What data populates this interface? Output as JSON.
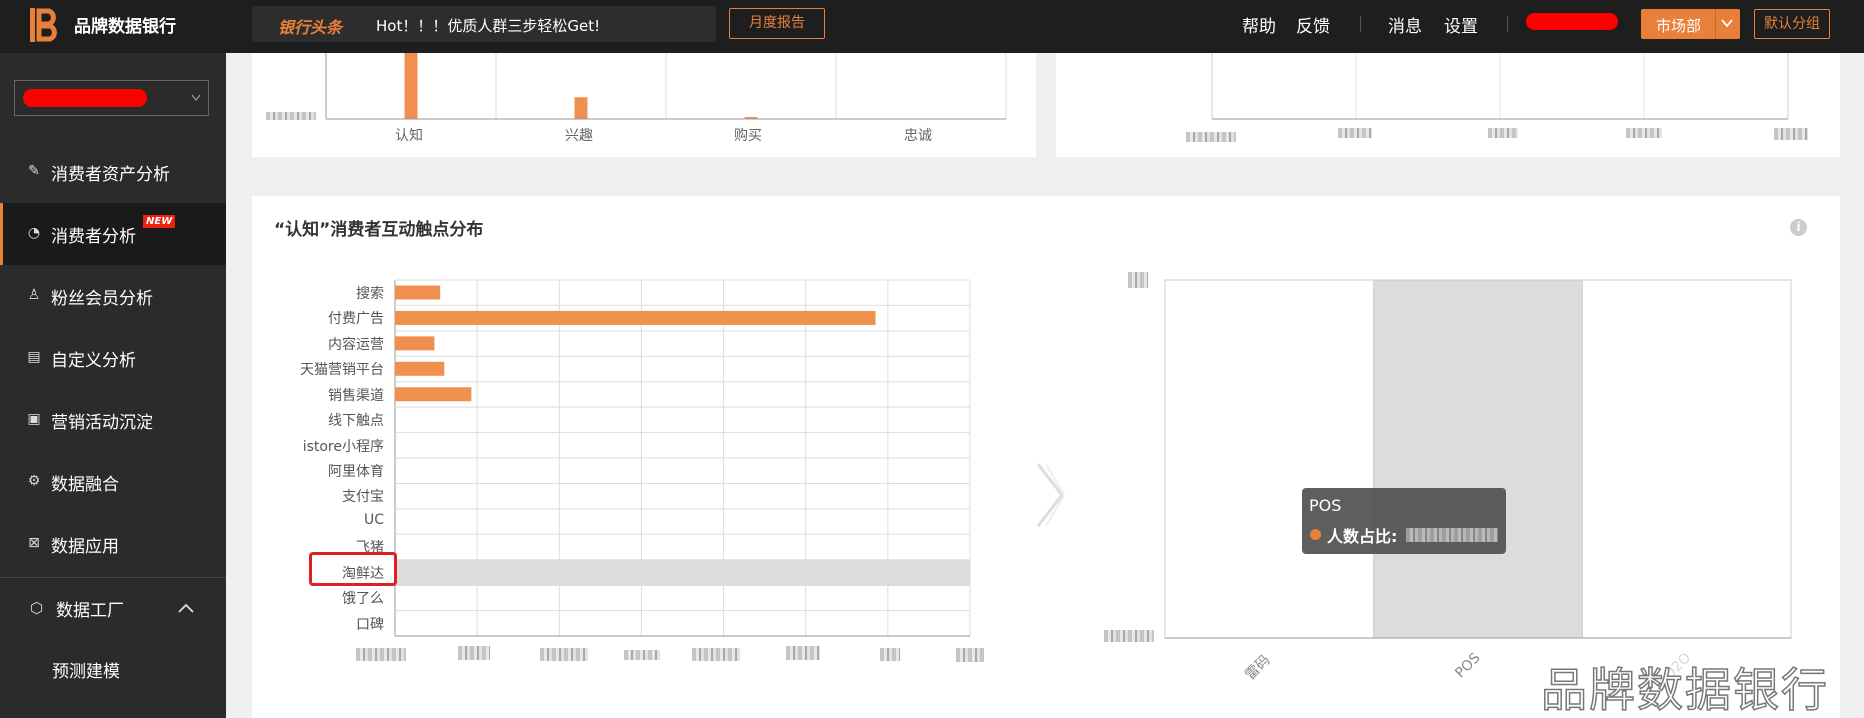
{
  "topbar": {
    "logo_text": "品牌数据银行",
    "news_tag": "银行头条",
    "news_text": "Hot！！！优质人群三步轻松Get!",
    "monthly_report": "月度报告",
    "nav": [
      "帮助",
      "反馈",
      "消息",
      "设置"
    ],
    "department": "市场部",
    "default_group": "默认分组"
  },
  "sidebar": {
    "items": [
      {
        "label": "消费者资产分析",
        "icon": "edit-icon"
      },
      {
        "label": "消费者分析",
        "icon": "gauge-icon",
        "badge": "NEW"
      },
      {
        "label": "粉丝会员分析",
        "icon": "users-icon"
      },
      {
        "label": "自定义分析",
        "icon": "custom-icon"
      },
      {
        "label": "营销活动沉淀",
        "icon": "campaign-icon"
      },
      {
        "label": "数据融合",
        "icon": "merge-icon"
      },
      {
        "label": "数据应用",
        "icon": "app-icon"
      }
    ],
    "factory": {
      "label": "数据工厂",
      "icon": "cube-icon"
    },
    "factory_sub": [
      "预测建模"
    ]
  },
  "top_left_chart": {
    "categories": [
      "认知",
      "兴趣",
      "购买",
      "忠诚"
    ]
  },
  "main_card": {
    "title": "“认知”消费者互动触点分布"
  },
  "chart_data": [
    {
      "type": "bar",
      "orientation": "horizontal",
      "categories": [
        "搜索",
        "付费广告",
        "内容运营",
        "天猫营销平台",
        "销售渠道",
        "线下触点",
        "istore小程序",
        "阿里体育",
        "支付宝",
        "UC",
        "飞猪",
        "淘鲜达",
        "饿了么",
        "口碑"
      ],
      "values": [
        0.55,
        5.85,
        0.48,
        0.6,
        0.93,
        0,
        0,
        0,
        0,
        0,
        0,
        0,
        0,
        0
      ],
      "xlim": [
        0,
        7
      ],
      "highlighted_category": "淘鲜达",
      "grid": true,
      "color": "#f0904f"
    },
    {
      "type": "bar",
      "categories": [
        "雷码",
        "POS",
        "O2O"
      ],
      "hover_category": "POS",
      "tooltip": {
        "title": "POS",
        "series_label": "人数占比:"
      },
      "grid": true
    },
    {
      "type": "bar",
      "categories": [
        "认知",
        "兴趣",
        "购买",
        "忠诚"
      ],
      "values": [
        1.0,
        0.33,
        0.01,
        0
      ],
      "color": "#f0904f"
    }
  ],
  "watermark": "品牌数据银行",
  "colors": {
    "accent": "#e8803a",
    "bar": "#f0904f",
    "alert": "#ff0000"
  }
}
